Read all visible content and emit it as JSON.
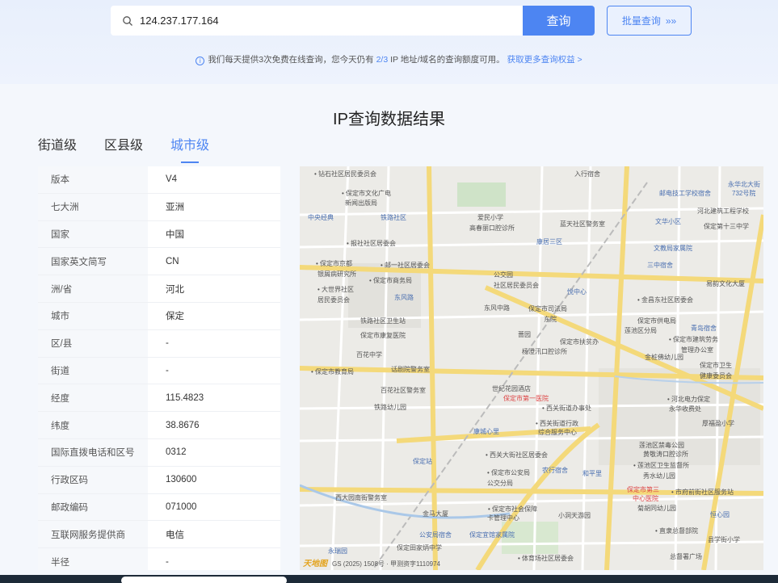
{
  "search": {
    "value": "124.237.177.164",
    "button_label": "查询",
    "batch_label": "批量查询",
    "batch_arrow": "»»"
  },
  "notice": {
    "prefix": "我们每天提供3次免费在线查询，您今天仍有",
    "remaining": "2/3",
    "suffix": "IP 地址/域名的查询额度可用。",
    "link": "获取更多查询权益 >"
  },
  "result_title": "IP查询数据结果",
  "tabs": [
    {
      "label": "街道级",
      "active": false
    },
    {
      "label": "区县级",
      "active": false
    },
    {
      "label": "城市级",
      "active": true
    }
  ],
  "info_rows": [
    {
      "key": "版本",
      "value": "V4"
    },
    {
      "key": "七大洲",
      "value": "亚洲"
    },
    {
      "key": "国家",
      "value": "中国"
    },
    {
      "key": "国家英文简写",
      "value": "CN"
    },
    {
      "key": "洲/省",
      "value": "河北"
    },
    {
      "key": "城市",
      "value": "保定"
    },
    {
      "key": "区/县",
      "value": "-"
    },
    {
      "key": "街道",
      "value": "-"
    },
    {
      "key": "经度",
      "value": "115.4823"
    },
    {
      "key": "纬度",
      "value": "38.8676"
    },
    {
      "key": "国际直拨电话和区号",
      "value": "0312"
    },
    {
      "key": "行政区码",
      "value": "130600"
    },
    {
      "key": "邮政编码",
      "value": "071000"
    },
    {
      "key": "互联网服务提供商",
      "value": "电信"
    },
    {
      "key": "半径",
      "value": "-"
    }
  ],
  "map": {
    "labels": [
      {
        "text": "• 钻石社区居民委员会",
        "style": ""
      },
      {
        "text": "• 保定市文化广电",
        "style": ""
      },
      {
        "text": "新闻出版局",
        "style": ""
      },
      {
        "text": "中央经典",
        "style": "blue"
      },
      {
        "text": "铁路社区",
        "style": "blue"
      },
      {
        "text": "爱民小学",
        "style": ""
      },
      {
        "text": "高春丽口腔诊所",
        "style": ""
      },
      {
        "text": "蓝天社区警务室",
        "style": ""
      },
      {
        "text": "入行宿舍",
        "style": ""
      },
      {
        "text": "邮电技工学校宿舍",
        "style": "blue"
      },
      {
        "text": "河北建筑工程学校",
        "style": ""
      },
      {
        "text": "文华小区",
        "style": "blue"
      },
      {
        "text": "保定第十三中学",
        "style": ""
      },
      {
        "text": "• 报社社区居委会",
        "style": ""
      },
      {
        "text": "康居三区",
        "style": "blue"
      },
      {
        "text": "文教局家属院",
        "style": "blue"
      },
      {
        "text": "• 保定市京都",
        "style": ""
      },
      {
        "text": "银屑病研究所",
        "style": ""
      },
      {
        "text": "• 邮一社区居委会",
        "style": ""
      },
      {
        "text": "三中宿舍",
        "style": "blue"
      },
      {
        "text": "• 保定市商务局",
        "style": ""
      },
      {
        "text": "公交园",
        "style": ""
      },
      {
        "text": "社区居民委员会",
        "style": ""
      },
      {
        "text": "• 大世界社区",
        "style": ""
      },
      {
        "text": "居民委员会",
        "style": ""
      },
      {
        "text": "东风路",
        "style": "blue"
      },
      {
        "text": "悦中心",
        "style": "blue"
      },
      {
        "text": "易韵文化大厦",
        "style": ""
      },
      {
        "text": "东风中路",
        "style": ""
      },
      {
        "text": "保定市司法局",
        "style": ""
      },
      {
        "text": "东院",
        "style": ""
      },
      {
        "text": "• 金昌东社区居委会",
        "style": ""
      },
      {
        "text": "铁路社区卫生站",
        "style": ""
      },
      {
        "text": "保定市供电局",
        "style": ""
      },
      {
        "text": "莲池区分局",
        "style": ""
      },
      {
        "text": "青岛宿舍",
        "style": "blue"
      },
      {
        "text": "保定市康复医院",
        "style": ""
      },
      {
        "text": "蔷园",
        "style": ""
      },
      {
        "text": "保定市扶贫办",
        "style": ""
      },
      {
        "text": "杨澄汛口腔诊所",
        "style": ""
      },
      {
        "text": "• 保定市建筑劳务",
        "style": ""
      },
      {
        "text": "管理办公室",
        "style": ""
      },
      {
        "text": "百花中学",
        "style": ""
      },
      {
        "text": "金桩佛幼儿园",
        "style": ""
      },
      {
        "text": "保定市卫生",
        "style": ""
      },
      {
        "text": "健康委员会",
        "style": ""
      },
      {
        "text": "• 保定市教育局",
        "style": ""
      },
      {
        "text": "话剧院警务室",
        "style": ""
      },
      {
        "text": "百花社区警务室",
        "style": ""
      },
      {
        "text": "世纪花园酒店",
        "style": ""
      },
      {
        "text": "保定市第一医院",
        "style": "red"
      },
      {
        "text": "• 河北电力保定",
        "style": ""
      },
      {
        "text": "永华收费处",
        "style": ""
      },
      {
        "text": "铁路幼儿园",
        "style": ""
      },
      {
        "text": "• 西关街道办事处",
        "style": ""
      },
      {
        "text": "厚福盈小学",
        "style": ""
      },
      {
        "text": "康城心里",
        "style": "blue"
      },
      {
        "text": "• 西关街道行政",
        "style": ""
      },
      {
        "text": "综合服务中心",
        "style": ""
      },
      {
        "text": "莲池区禁毒公园",
        "style": ""
      },
      {
        "text": "黄敬涛口腔诊所",
        "style": ""
      },
      {
        "text": "• 西关大街社区居委会",
        "style": ""
      },
      {
        "text": "保定站",
        "style": "blue"
      },
      {
        "text": "• 保定市公安局",
        "style": ""
      },
      {
        "text": "公交分局",
        "style": ""
      },
      {
        "text": "农行宿舍",
        "style": "blue"
      },
      {
        "text": "和平里",
        "style": "blue"
      },
      {
        "text": "• 莲池区卫生监督所",
        "style": ""
      },
      {
        "text": "秀水幼儿园",
        "style": ""
      },
      {
        "text": "西大园南街警务室",
        "style": ""
      },
      {
        "text": "保定市第三",
        "style": "red"
      },
      {
        "text": "中心医院",
        "style": "red"
      },
      {
        "text": "• 市府前街社区服务站",
        "style": ""
      },
      {
        "text": "• 保定市社会保障",
        "style": ""
      },
      {
        "text": "卡管理中心",
        "style": ""
      },
      {
        "text": "菊胡同幼儿园",
        "style": ""
      },
      {
        "text": "金马大厦",
        "style": ""
      },
      {
        "text": "小洞天游园",
        "style": ""
      },
      {
        "text": "恒心园",
        "style": "blue"
      },
      {
        "text": "公安局宿舍",
        "style": "blue"
      },
      {
        "text": "保定宜馆家属院",
        "style": "blue"
      },
      {
        "text": "• 直隶总督部院",
        "style": ""
      },
      {
        "text": "县学街小学",
        "style": ""
      },
      {
        "text": "保定田家炳中学",
        "style": ""
      },
      {
        "text": "永瑞园",
        "style": "blue"
      },
      {
        "text": "• 体育场社区居委会",
        "style": ""
      },
      {
        "text": "总督署广场",
        "style": ""
      },
      {
        "text": "永华北大街",
        "style": "blue"
      },
      {
        "text": "732号院",
        "style": "blue"
      }
    ],
    "logo": "天地图",
    "copyright": "GS (2025) 1508号 · 甲测资字1110974"
  }
}
